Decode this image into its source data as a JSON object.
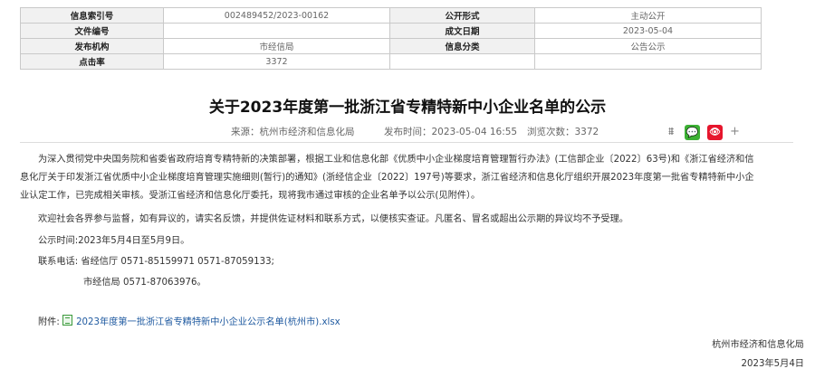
{
  "meta": {
    "rows": [
      [
        "信息索引号",
        "002489452/2023-00162",
        "公开形式",
        "主动公开"
      ],
      [
        "文件编号",
        "",
        "成文日期",
        "2023-05-04"
      ],
      [
        "发布机构",
        "市经信局",
        "信息分类",
        "公告公示"
      ],
      [
        "点击率",
        "3372",
        "",
        ""
      ]
    ]
  },
  "article": {
    "title": "关于2023年度第一批浙江省专精特新中小企业名单的公示",
    "source": "来源：杭州市经济和信息化局",
    "publish_time": "发布时间：2023-05-04 16:55",
    "views": "浏览次数：3372",
    "share_icons": [
      "share-icon",
      "wechat-icon",
      "weibo-icon",
      "plus-icon"
    ],
    "paragraph1_line1": "为深入贯彻党中央国务院和省委省政府培育专精特新的决策部署，根据工业和信息化部《优质中小企业梯度培育管理暂行办法》(工信部企业〔2022〕63号)和《浙江省经济和信",
    "paragraph1_line2": "息化厅关于印发浙江省优质中小企业梯度培育管理实施细则(暂行)的通知》(浙经信企业〔2022〕197号)等要求，浙江省经济和信息化厅组织开展2023年度第一批省专精特新中小企",
    "paragraph1_line3": "业认定工作，已完成相关审核。受浙江省经济和信息化厅委托，现将我市通过审核的企业名单予以公示(见附件）。",
    "paragraph2": "欢迎社会各界参与监督，如有异议的，请实名反馈，并提供佐证材料和联系方式，以便核实查证。凡匿名、冒名或超出公示期的异议均不予受理。",
    "period": "公示时间:2023年5月4日至5月9日。",
    "contact_line1": "联系电话: 省经信厅 0571-85159971 0571-87059133;",
    "contact_line2": "市经信局 0571-87063976。",
    "attachment_label": "附件:",
    "attachment_name": "2023年度第一批浙江省专精特新中小企业公示名单(杭州市).xlsx",
    "signature_org": "杭州市经济和信息化局",
    "signature_date": "2023年5月4日"
  },
  "colors": {
    "link": "#1f5aa0",
    "wechat": "#3cb034",
    "weibo": "#e6162d"
  }
}
